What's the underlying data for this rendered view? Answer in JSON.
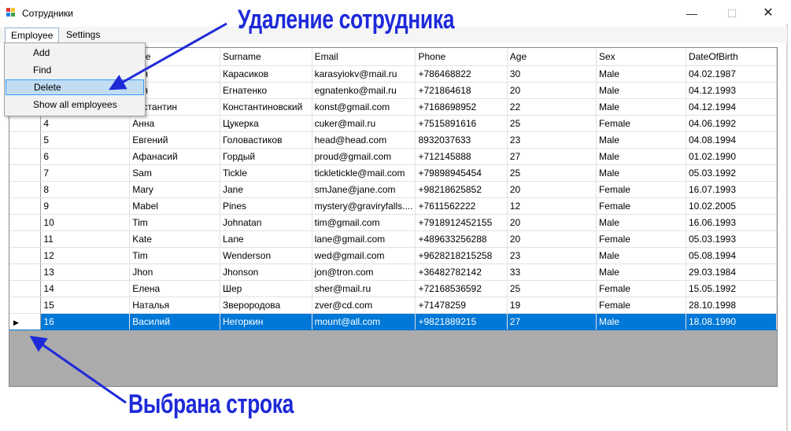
{
  "window": {
    "title": "Сотрудники",
    "controls": {
      "minimize": "—",
      "maximize": "☐",
      "close": "✕"
    }
  },
  "menubar": {
    "employee": "Employee",
    "settings": "Settings"
  },
  "dropdown": {
    "items": [
      "Add",
      "Find",
      "Delete",
      "Show all employees"
    ],
    "highlighted_index": 2
  },
  "grid": {
    "columns": [
      "",
      "ame",
      "Surname",
      "Email",
      "Phone",
      "Age",
      "Sex",
      "DateOfBirth"
    ],
    "rows": [
      [
        "",
        "лья",
        "Карасиков",
        "karasyiokv@mail.ru",
        "+786468822",
        "30",
        "Male",
        "04.02.1987"
      ],
      [
        "",
        "лья",
        "Егнатенко",
        "egnatenko@mail.ru",
        "+721864618",
        "20",
        "Male",
        "04.12.1993"
      ],
      [
        "",
        "онстантин",
        "Константиновский",
        "konst@gmail.com",
        "+7168698952",
        "22",
        "Male",
        "04.12.1994"
      ],
      [
        "4",
        "Анна",
        "Цукерка",
        "cuker@mail.ru",
        "+7515891616",
        "25",
        "Female",
        "04.06.1992"
      ],
      [
        "5",
        "Евгений",
        "Головастиков",
        "head@head.com",
        "8932037633",
        "23",
        "Male",
        "04.08.1994"
      ],
      [
        "6",
        "Афанасий",
        "Гордый",
        "proud@gmail.com",
        "+712145888",
        "27",
        "Male",
        "01.02.1990"
      ],
      [
        "7",
        "Sam",
        "Tickle",
        "tickletickle@mail.com",
        "+79898945454",
        "25",
        "Male",
        "05.03.1992"
      ],
      [
        "8",
        "Mary",
        "Jane",
        "smJane@jane.com",
        "+98218625852",
        "20",
        "Female",
        "16.07.1993"
      ],
      [
        "9",
        "Mabel",
        "Pines",
        "mystery@graviryfalls....",
        "+7611562222",
        "12",
        "Female",
        "10.02.2005"
      ],
      [
        "10",
        "Tim",
        "Johnatan",
        "tim@gmail.com",
        "+7918912452155",
        "20",
        "Male",
        "16.06.1993"
      ],
      [
        "11",
        "Kate",
        "Lane",
        "lane@gmail.com",
        "+489633256288",
        "20",
        "Female",
        "05.03.1993"
      ],
      [
        "12",
        "Tim",
        "Wenderson",
        "wed@gmail.com",
        "+9628218215258",
        "23",
        "Male",
        "05.08.1994"
      ],
      [
        "13",
        "Jhon",
        "Jhonson",
        "jon@tron.com",
        "+36482782142",
        "33",
        "Male",
        "29.03.1984"
      ],
      [
        "14",
        "Елена",
        "Шер",
        "sher@mail.ru",
        "+72168536592",
        "25",
        "Female",
        "15.05.1992"
      ],
      [
        "15",
        "Наталья",
        "Зверородова",
        "zver@cd.com",
        "+71478259",
        "19",
        "Female",
        "28.10.1998"
      ],
      [
        "16",
        "Василий",
        "Негоркин",
        "mount@all.com",
        "+9821889215",
        "27",
        "Male",
        "18.08.1990"
      ]
    ],
    "selected_row": 15,
    "row_marker": "▶"
  },
  "scrollbar": {
    "left": "◀",
    "right": "▶"
  },
  "annotations": {
    "delete_label": "Удаление сотрудника",
    "selected_label": "Выбрана строка",
    "color": "#1e2ad8"
  },
  "colors": {
    "selection": "#0078d7",
    "menu_highlight": "#c1dcf3",
    "grid_background": "#ababab"
  }
}
